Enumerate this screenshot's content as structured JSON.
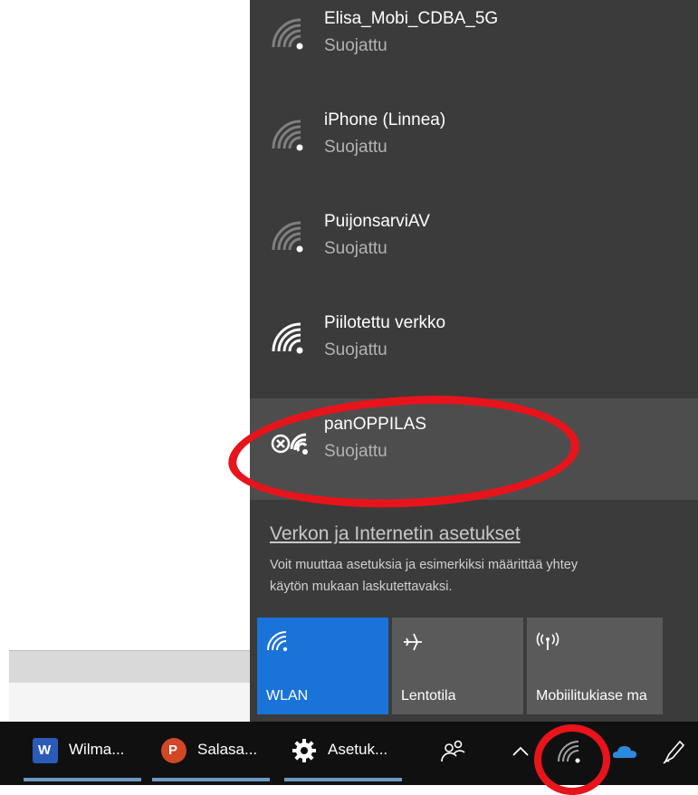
{
  "networks": [
    {
      "name": "Elisa_Mobi_CDBA_5G",
      "status": "Suojattu",
      "signal": "weak",
      "icon": "wifi-weak-icon"
    },
    {
      "name": "iPhone (Linnea)",
      "status": "Suojattu",
      "signal": "weak",
      "icon": "wifi-weak-icon"
    },
    {
      "name": "PuijonsarviAV",
      "status": "Suojattu",
      "signal": "weak",
      "icon": "wifi-weak-icon"
    },
    {
      "name": "Piilotettu verkko",
      "status": "Suojattu",
      "signal": "full",
      "icon": "wifi-full-icon"
    },
    {
      "name": "panOPPILAS",
      "status": "Suojattu",
      "signal": "error",
      "icon": "wifi-error-icon"
    }
  ],
  "settings": {
    "link": "Verkon ja Internetin asetukset",
    "description_line1": "Voit muuttaa asetuksia ja esimerkiksi määrittää yhtey",
    "description_line2": "käytön mukaan laskutettavaksi."
  },
  "quick_actions": [
    {
      "label": "WLAN",
      "active": true,
      "icon": "wifi-icon"
    },
    {
      "label": "Lentotila",
      "active": false,
      "icon": "airplane-icon"
    },
    {
      "label": "Mobiilitukiase ma",
      "active": false,
      "icon": "mobile-hotspot-icon"
    }
  ],
  "taskbar": {
    "apps": [
      {
        "label": "Wilma...",
        "icon": "word-icon",
        "icon_letter": "W",
        "color": "#2b5bb8"
      },
      {
        "label": "Salasa...",
        "icon": "powerpoint-icon",
        "icon_letter": "P",
        "color": "#d24726"
      },
      {
        "label": "Asetuk...",
        "icon": "gear-icon"
      }
    ],
    "tray_icons": [
      "people-icon",
      "chevron-up-icon",
      "wifi-icon",
      "onedrive-cloud-icon",
      "pen-icon"
    ]
  },
  "colors": {
    "flyout_bg": "#3b3b3b",
    "accent": "#1a73d9",
    "annotation": "#e8141b"
  }
}
